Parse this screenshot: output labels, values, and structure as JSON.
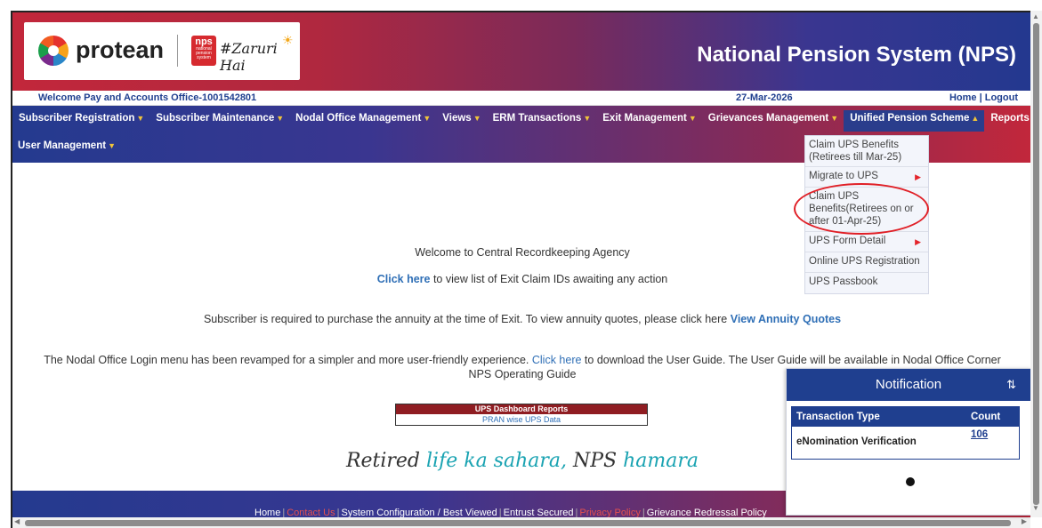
{
  "header": {
    "brand": "protean",
    "nps_logo_main": "nps",
    "nps_logo_sub": "national pension system",
    "tagline_logo": "#Zaruri Hai",
    "site_title": "National Pension System (NPS)"
  },
  "welcome_bar": {
    "welcome": "Welcome Pay and Accounts Office-1001542801",
    "date": "27-Mar-2026",
    "home_logout": "Home | Logout"
  },
  "nav": {
    "row1": [
      {
        "label": "Subscriber Registration"
      },
      {
        "label": "Subscriber Maintenance"
      },
      {
        "label": "Nodal Office Management"
      },
      {
        "label": "Views"
      },
      {
        "label": "ERM Transactions"
      },
      {
        "label": "Exit Management"
      },
      {
        "label": "Grievances Management"
      },
      {
        "label": "Unified Pension Scheme"
      },
      {
        "label": "Reports"
      }
    ],
    "row2": [
      {
        "label": "User Management"
      }
    ]
  },
  "dropdown": {
    "items": [
      {
        "label": "Claim UPS Benefits (Retirees till Mar-25)",
        "has_submenu": false
      },
      {
        "label": "Migrate to UPS",
        "has_submenu": true
      },
      {
        "label": "Claim UPS Benefits(Retirees on or after 01-Apr-25)",
        "has_submenu": false
      },
      {
        "label": "UPS Form Detail",
        "has_submenu": true
      },
      {
        "label": "Online UPS Registration",
        "has_submenu": false
      },
      {
        "label": "UPS Passbook",
        "has_submenu": false
      }
    ]
  },
  "main": {
    "welcome_line": "Welcome to Central Recordkeeping Agency",
    "exit_claim_link": "Click here",
    "exit_claim_text": " to view list of Exit Claim IDs awaiting any action",
    "annuity_text": "Subscriber is required to purchase the annuity at the time of Exit. To view annuity quotes, please click here ",
    "annuity_link": "View Annuity Quotes",
    "revamp_text_1": "The Nodal Office Login menu has been revamped for a simpler and more user-friendly experience. ",
    "revamp_link": "Click here",
    "revamp_text_2": " to download the User Guide. The User Guide will be available in Nodal Office Corner",
    "operating_guide": "NPS Operating Guide",
    "ups_table_header": "UPS Dashboard Reports",
    "ups_table_row": "PRAN wise UPS Data",
    "tagline_1": "Retired ",
    "tagline_2": "life ka sahara,",
    "tagline_3": " NPS ",
    "tagline_4": "hamara"
  },
  "footer": {
    "links": [
      "Home",
      "Contact Us",
      "System Configuration / Best Viewed",
      "Entrust Secured",
      "Privacy Policy",
      "Grievance Redressal Policy"
    ]
  },
  "notification": {
    "title": "Notification",
    "sort_icon": "⇅",
    "col_type": "Transaction Type",
    "col_count": "Count",
    "rows": [
      {
        "type": "eNomination Verification",
        "count": "106"
      }
    ]
  },
  "colors": {
    "brand_red": "#c2273b",
    "brand_blue": "#23388f",
    "link_blue": "#2f6fb6",
    "annotation_red": "#e01f26"
  }
}
